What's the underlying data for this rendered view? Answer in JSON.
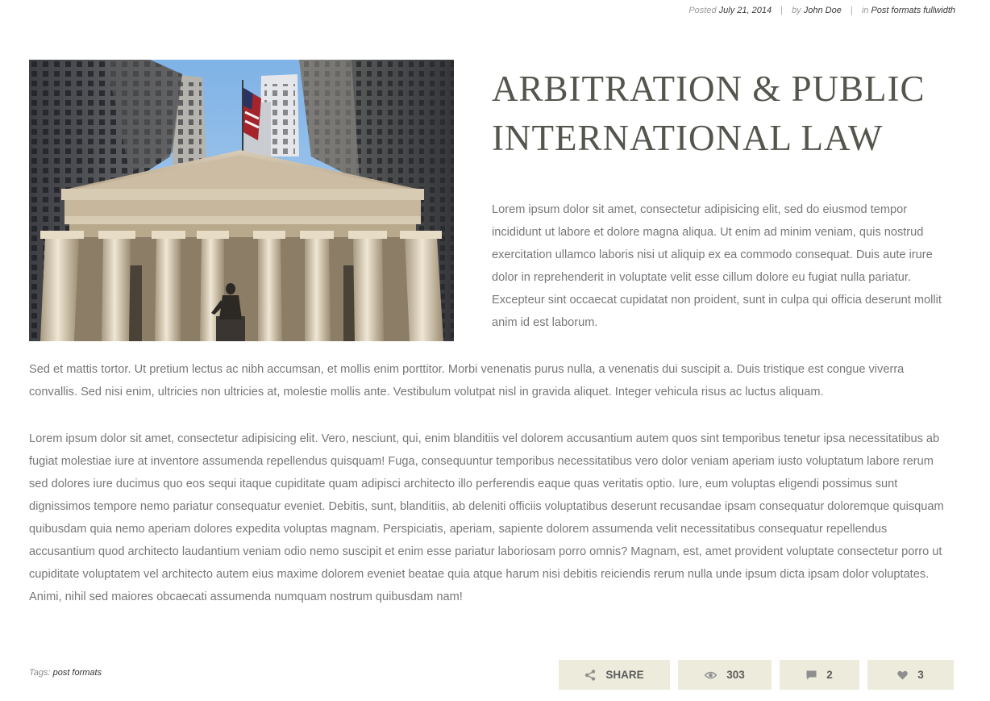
{
  "post_meta": {
    "posted_prefix": "Posted",
    "date": "July 21, 2014",
    "by_prefix": "by",
    "author": "John Doe",
    "in_prefix": "in",
    "category": "Post formats fullwidth",
    "separator": "|"
  },
  "article": {
    "title": "ARBITRATION & PUBLIC INTERNATIONAL LAW",
    "paragraphs": [
      "Lorem ipsum dolor sit amet, consectetur adipisicing elit, sed do eiusmod tempor incididunt ut labore et dolore magna aliqua. Ut enim ad minim veniam, quis nostrud exercitation ullamco laboris nisi ut aliquip ex ea commodo consequat. Duis aute irure dolor in reprehenderit in voluptate velit esse cillum dolore eu fugiat nulla pariatur. Excepteur sint occaecat cupidatat non proident, sunt in culpa qui officia deserunt mollit anim id est laborum.",
      "Sed et mattis tortor. Ut pretium lectus ac nibh accumsan, et mollis enim porttitor. Morbi venenatis purus nulla, a venenatis dui suscipit a. Duis tristique est congue viverra convallis. Sed nisi enim, ultricies non ultricies at, molestie mollis ante. Vestibulum volutpat nisl in gravida aliquet. Integer vehicula risus ac luctus aliquam.",
      "Lorem ipsum dolor sit amet, consectetur adipisicing elit. Vero, nesciunt, qui, enim blanditiis vel dolorem accusantium autem quos sint temporibus tenetur ipsa necessitatibus ab fugiat molestiae iure at inventore assumenda repellendus quisquam! Fuga, consequuntur temporibus necessitatibus vero dolor veniam aperiam iusto voluptatum labore rerum sed dolores iure ducimus quo eos sequi itaque cupiditate quam adipisci architecto illo perferendis eaque quas veritatis optio. Iure, eum voluptas eligendi possimus sunt dignissimos tempore nemo pariatur consequatur eveniet. Debitis, sunt, blanditiis, ab deleniti officiis voluptatibus deserunt recusandae ipsam consequatur doloremque quisquam quibusdam quia nemo aperiam dolores expedita voluptas magnam. Perspiciatis, aperiam, sapiente dolorem assumenda velit necessitatibus consequatur repellendus accusantium quod architecto laudantium veniam odio nemo suscipit et enim esse pariatur laboriosam porro omnis? Magnam, est, amet provident voluptate consectetur porro ut cupiditate voluptatem vel architecto autem eius maxime dolorem eveniet beatae quia atque harum nisi debitis reiciendis rerum nulla unde ipsum dicta ipsam dolor voluptates. Animi, nihil sed maiores obcaecati assumenda numquam nostrum quibusdam nam!"
    ]
  },
  "footer": {
    "tags_label": "Tags:",
    "tag": "post formats",
    "share_label": "SHARE",
    "views_count": "303",
    "comments_count": "2",
    "likes_count": "3"
  },
  "icons": {
    "share": "share-icon",
    "views": "eye-icon",
    "comments": "comment-icon",
    "likes": "heart-icon"
  },
  "colors": {
    "title": "#55554e",
    "body_text": "#77777a",
    "button_bg": "#ecebdc",
    "button_text": "#5d5d5d"
  }
}
